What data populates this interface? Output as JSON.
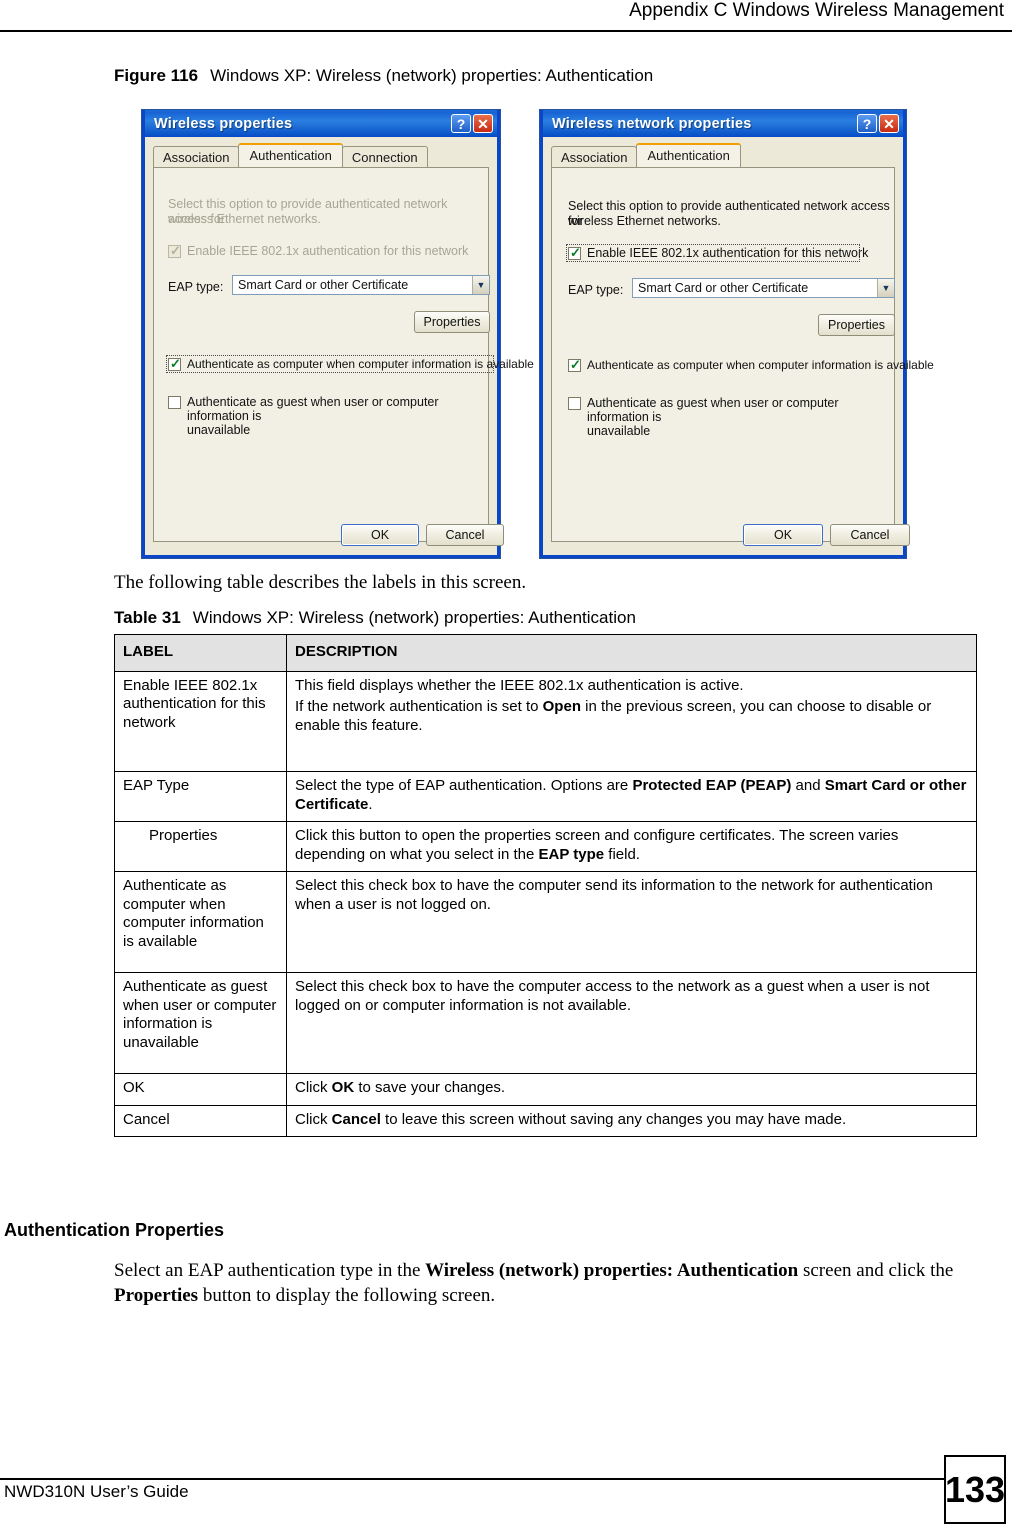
{
  "page": {
    "running_header": "Appendix C Windows Wireless Management",
    "footer_guide": "NWD310N User’s Guide",
    "page_number": "133"
  },
  "figure": {
    "label": "Figure 116",
    "title": "Windows XP: Wireless (network) properties: Authentication"
  },
  "dialog_left": {
    "title": "Wireless properties",
    "help_icon": "?",
    "close_icon": "✕",
    "tabs": [
      {
        "label": "Association",
        "active": false
      },
      {
        "label": "Authentication",
        "active": true
      },
      {
        "label": "Connection",
        "active": false
      }
    ],
    "description_line1": "Select this option to provide authenticated network access for",
    "description_line2": "wireless Ethernet networks.",
    "enable_8021x_label": "Enable IEEE 802.1x authentication for this network",
    "enable_8021x_checked": true,
    "eap_type_label": "EAP type:",
    "eap_type_value": "Smart Card or other Certificate",
    "properties_button": "Properties",
    "auth_computer_label": "Authenticate as computer when computer information is available",
    "auth_computer_checked": true,
    "auth_guest_line1": "Authenticate as guest when user or computer information is",
    "auth_guest_line2": "unavailable",
    "auth_guest_checked": false,
    "ok_button": "OK",
    "cancel_button": "Cancel"
  },
  "dialog_right": {
    "title": "Wireless network properties",
    "help_icon": "?",
    "close_icon": "✕",
    "tabs": [
      {
        "label": "Association",
        "active": false
      },
      {
        "label": "Authentication",
        "active": true
      }
    ],
    "description_line1": "Select this option to provide authenticated network access for",
    "description_line2": "wireless Ethernet networks.",
    "enable_8021x_label": "Enable IEEE 802.1x authentication for this network",
    "enable_8021x_checked": true,
    "eap_type_label": "EAP type:",
    "eap_type_value": "Smart Card or other Certificate",
    "properties_button": "Properties",
    "auth_computer_label": "Authenticate as computer when computer information is available",
    "auth_computer_checked": true,
    "auth_guest_line1": "Authenticate as guest when user or computer information is",
    "auth_guest_line2": "unavailable",
    "auth_guest_checked": false,
    "ok_button": "OK",
    "cancel_button": "Cancel"
  },
  "intro_paragraph": "The following table describes the labels in this screen.",
  "table": {
    "label": "Table 31",
    "title": "Windows XP: Wireless (network) properties: Authentication",
    "headers": [
      "LABEL",
      "DESCRIPTION"
    ],
    "rows": [
      {
        "label": "Enable IEEE 802.1x authentication for this network",
        "indent": false,
        "desc_p1_a": "This field displays whether the IEEE 802.1x authentication is active.",
        "desc_p2_a": "If the network authentication is set to ",
        "desc_p2_b": "Open",
        "desc_p2_c": " in the previous screen, you can choose to disable or enable this feature."
      },
      {
        "label": "EAP Type",
        "indent": false,
        "desc_p1_a": "Select the type of EAP authentication. Options are ",
        "desc_p1_b": "Protected EAP (PEAP)",
        "desc_p1_c": " and ",
        "desc_p1_d": "Smart Card or other Certificate",
        "desc_p1_e": "."
      },
      {
        "label": "Properties",
        "indent": true,
        "desc_p1_a": "Click this button to open the properties screen and configure certificates. The screen varies depending on what you select in the ",
        "desc_p1_b": "EAP type",
        "desc_p1_c": " field."
      },
      {
        "label": "Authenticate as computer when computer information is available",
        "indent": false,
        "desc_p1_a": "Select this check box to have the computer send its information to the network for authentication when a user is not logged on."
      },
      {
        "label": "Authenticate as guest when user or computer information is unavailable",
        "indent": false,
        "desc_p1_a": "Select this check box to have the computer access to the network as a guest when a user is not logged on or computer information is not available."
      },
      {
        "label": "OK",
        "indent": false,
        "desc_p1_a": "Click ",
        "desc_p1_b": "OK",
        "desc_p1_c": " to save your changes."
      },
      {
        "label": "Cancel",
        "indent": false,
        "desc_p1_a": "Click ",
        "desc_p1_b": "Cancel",
        "desc_p1_c": " to leave this screen without saving any changes you may have made."
      }
    ]
  },
  "section": {
    "heading": "Authentication Properties",
    "para_a": "Select an EAP authentication type in the ",
    "para_b": "Wireless (network) properties: Authentication",
    "para_c": " screen and click the ",
    "para_d": "Properties",
    "para_e": " button to display the following screen."
  }
}
